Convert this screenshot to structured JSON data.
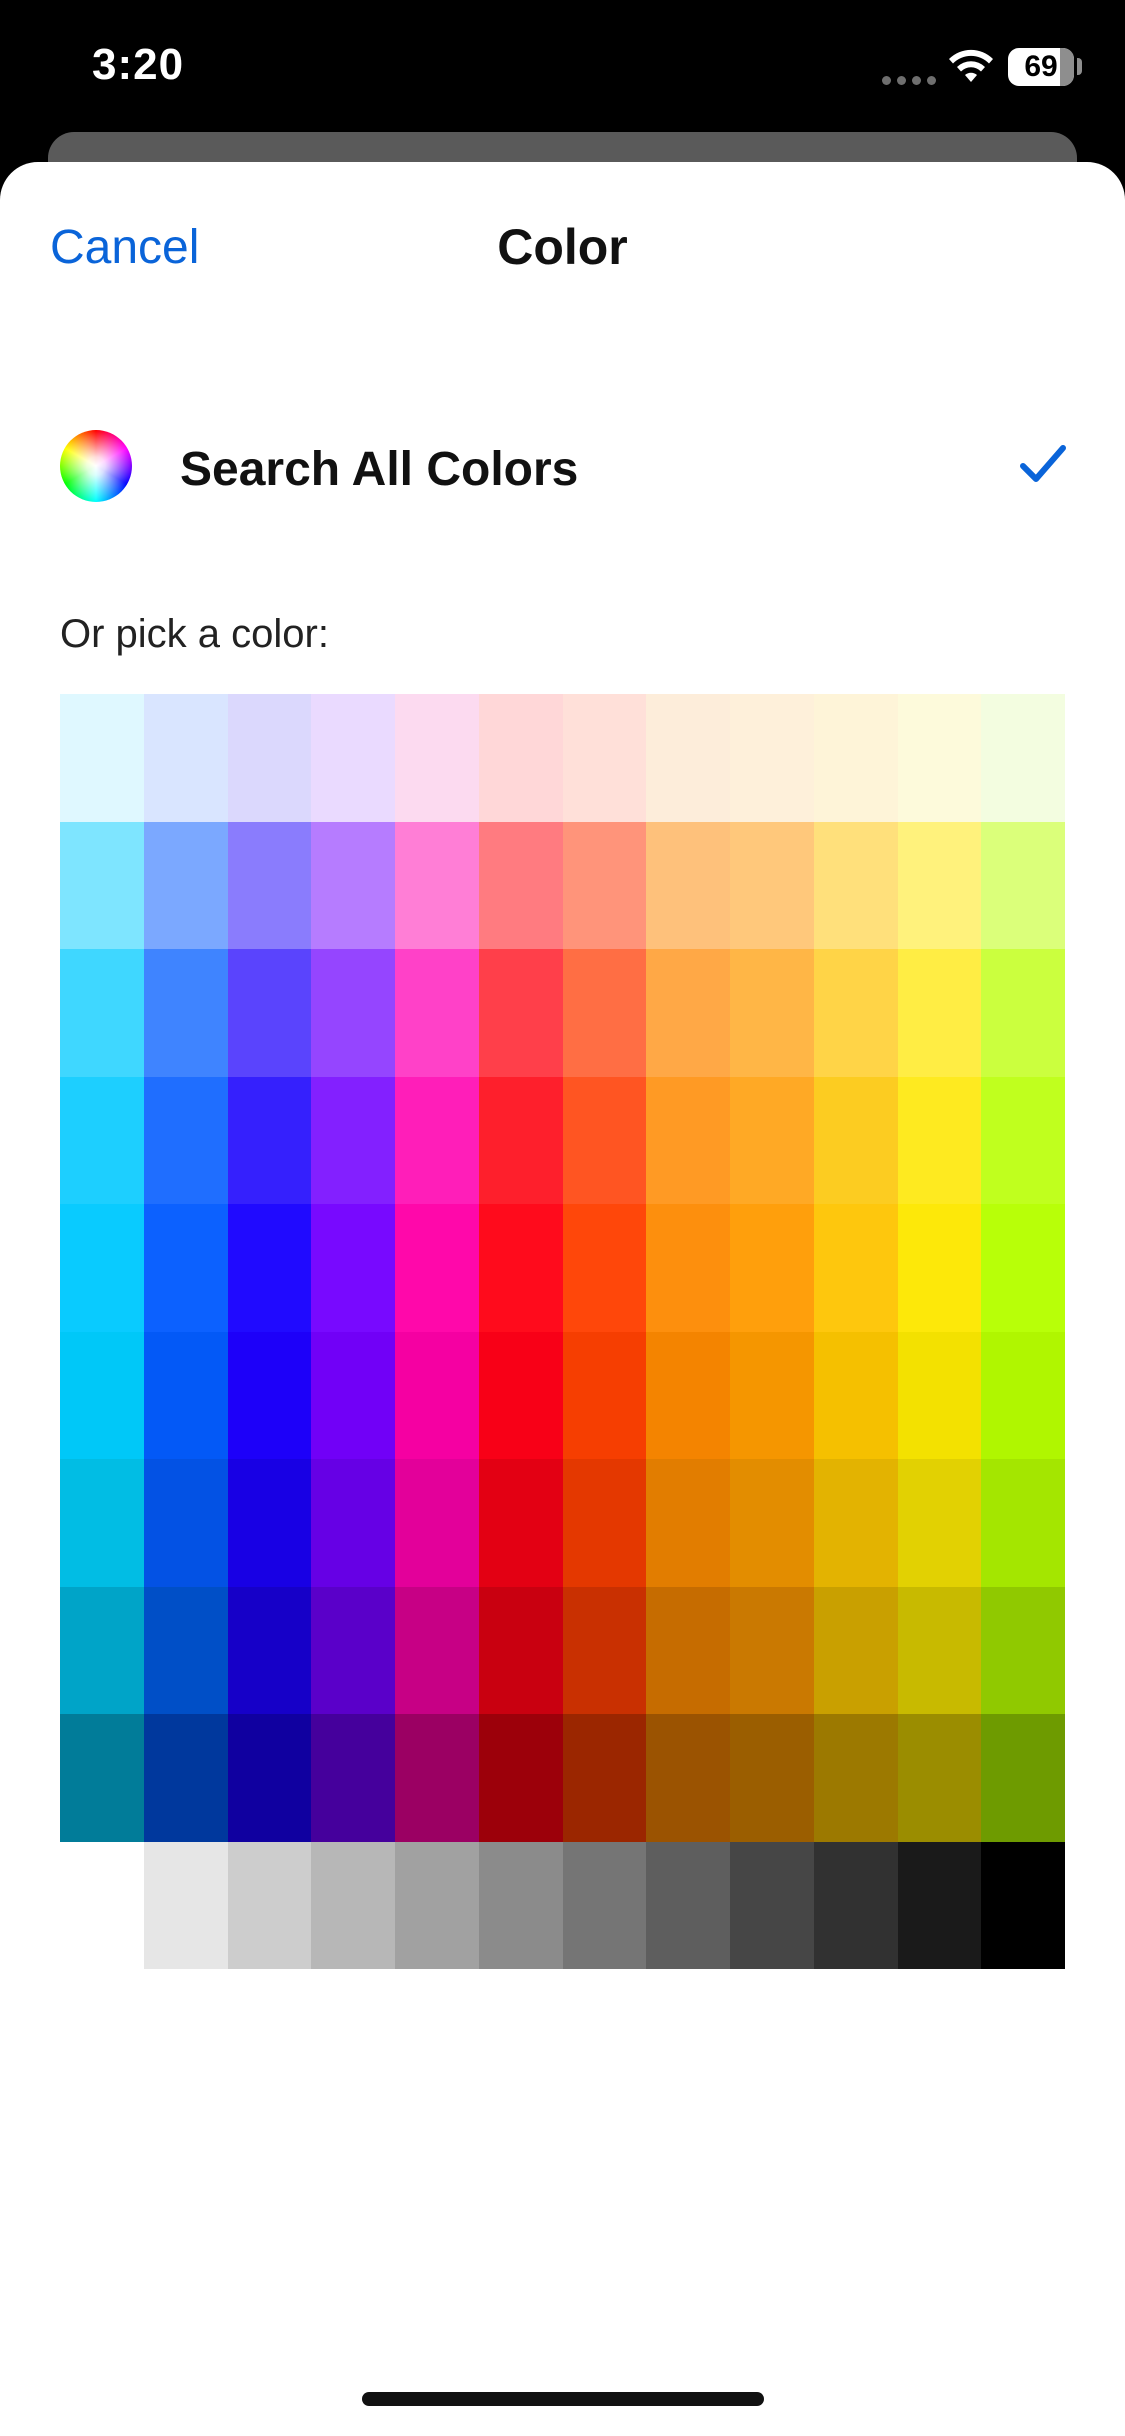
{
  "status_bar": {
    "time": "3:20",
    "battery": "69",
    "icons": [
      "cellular-dots-icon",
      "wifi-icon",
      "battery-icon"
    ]
  },
  "header": {
    "cancel_label": "Cancel",
    "title": "Color"
  },
  "search_all": {
    "label": "Search All Colors",
    "icon": "color-wheel-icon",
    "selected": true,
    "check_icon": "checkmark-icon"
  },
  "pick_label": "Or pick a color:",
  "colors": {
    "accent": "#0a64d9",
    "palette_rows": [
      [
        "#dff8ff",
        "#d9e5ff",
        "#dbd8fd",
        "#eadaff",
        "#fcdaf0",
        "#ffd7d8",
        "#ffe0d9",
        "#fdedda",
        "#fef0da",
        "#fef4d8",
        "#fdfadb",
        "#f3fde0"
      ],
      [
        "#7ee5ff",
        "#7ba8ff",
        "#8a7cfd",
        "#b67cff",
        "#ff7ed6",
        "#ff7b80",
        "#ff947a",
        "#fec17b",
        "#ffc87b",
        "#ffe07b",
        "#fff27c",
        "#dbff7a"
      ],
      [
        "#3fd7ff",
        "#3f84ff",
        "#5a44fd",
        "#9545ff",
        "#ff41c8",
        "#ff3f4a",
        "#ff6e44",
        "#ffa846",
        "#ffb646",
        "#ffd447",
        "#ffed44",
        "#cbff3e"
      ],
      [
        "#1dcfff",
        "#1f6eff",
        "#3520fd",
        "#8320ff",
        "#ff1eb9",
        "#fe1f2c",
        "#ff5522",
        "#ff9a24",
        "#ffa925",
        "#fccc21",
        "#feea20",
        "#c0ff1e"
      ],
      [
        "#09cbff",
        "#0c61ff",
        "#200aff",
        "#7809ff",
        "#ff08aa",
        "#ff0b1c",
        "#ff470a",
        "#fd8f0d",
        "#ff9f0c",
        "#fec70d",
        "#fde809",
        "#b8ff08"
      ],
      [
        "#00c8f8",
        "#0359f7",
        "#1d00f9",
        "#7100f7",
        "#f500a2",
        "#f80017",
        "#f63e01",
        "#f48400",
        "#f59600",
        "#f5c000",
        "#f3e100",
        "#b0f600"
      ],
      [
        "#01bde4",
        "#0352e4",
        "#1800e4",
        "#6600e5",
        "#e3009a",
        "#e30013",
        "#e43800",
        "#e27d00",
        "#e38d00",
        "#e3b301",
        "#e2d102",
        "#a4e600"
      ],
      [
        "#00a4c8",
        "#004fc7",
        "#1600c8",
        "#5a00c9",
        "#c70085",
        "#c90010",
        "#c93001",
        "#c66c00",
        "#ca7901",
        "#c9a000",
        "#c8ba00",
        "#90c900"
      ],
      [
        "#017c99",
        "#00389d",
        "#1000a0",
        "#45009c",
        "#9b0063",
        "#9c000a",
        "#9b2600",
        "#9b5301",
        "#9b5e00",
        "#9c7900",
        "#9b8d00",
        "#6e9b00"
      ],
      [
        "#ffffff",
        "#e6e6e6",
        "#cdcdcd",
        "#b7b7b7",
        "#a1a1a1",
        "#8b8b8b",
        "#757575",
        "#5e5e5e",
        "#464646",
        "#313131",
        "#1a1a1a",
        "#000000"
      ]
    ]
  }
}
